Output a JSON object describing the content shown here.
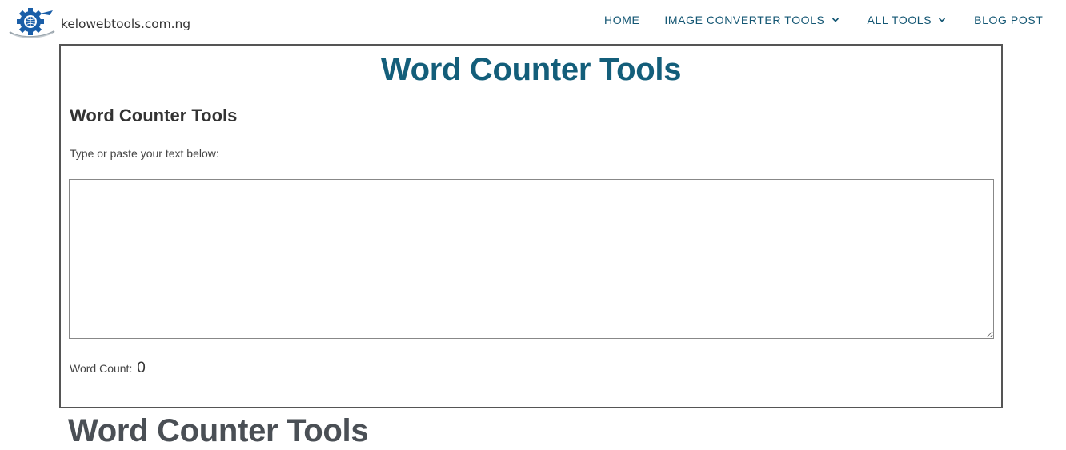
{
  "header": {
    "logo_text": "kelowebtools.com.ng",
    "nav": {
      "home": "HOME",
      "image_converter": "IMAGE CONVERTER TOOLS",
      "all_tools": "ALL TOOLS",
      "blog_post": "BLOG POST"
    },
    "icons": {
      "logo": "gear-globe-logo",
      "search": "search-icon",
      "dropdown": "chevron-down-icon"
    }
  },
  "tool": {
    "main_title": "Word Counter Tools",
    "sub_title": "Word Counter Tools",
    "instruction": "Type or paste your text below:",
    "textarea_value": "",
    "word_count_label": "Word Count:",
    "word_count_value": "0"
  },
  "page": {
    "bottom_title": "Word Counter Tools"
  },
  "colors": {
    "nav_text": "#135673",
    "main_title": "#135e7a",
    "logo_blue": "#1a5ea8",
    "border": "#555555"
  }
}
